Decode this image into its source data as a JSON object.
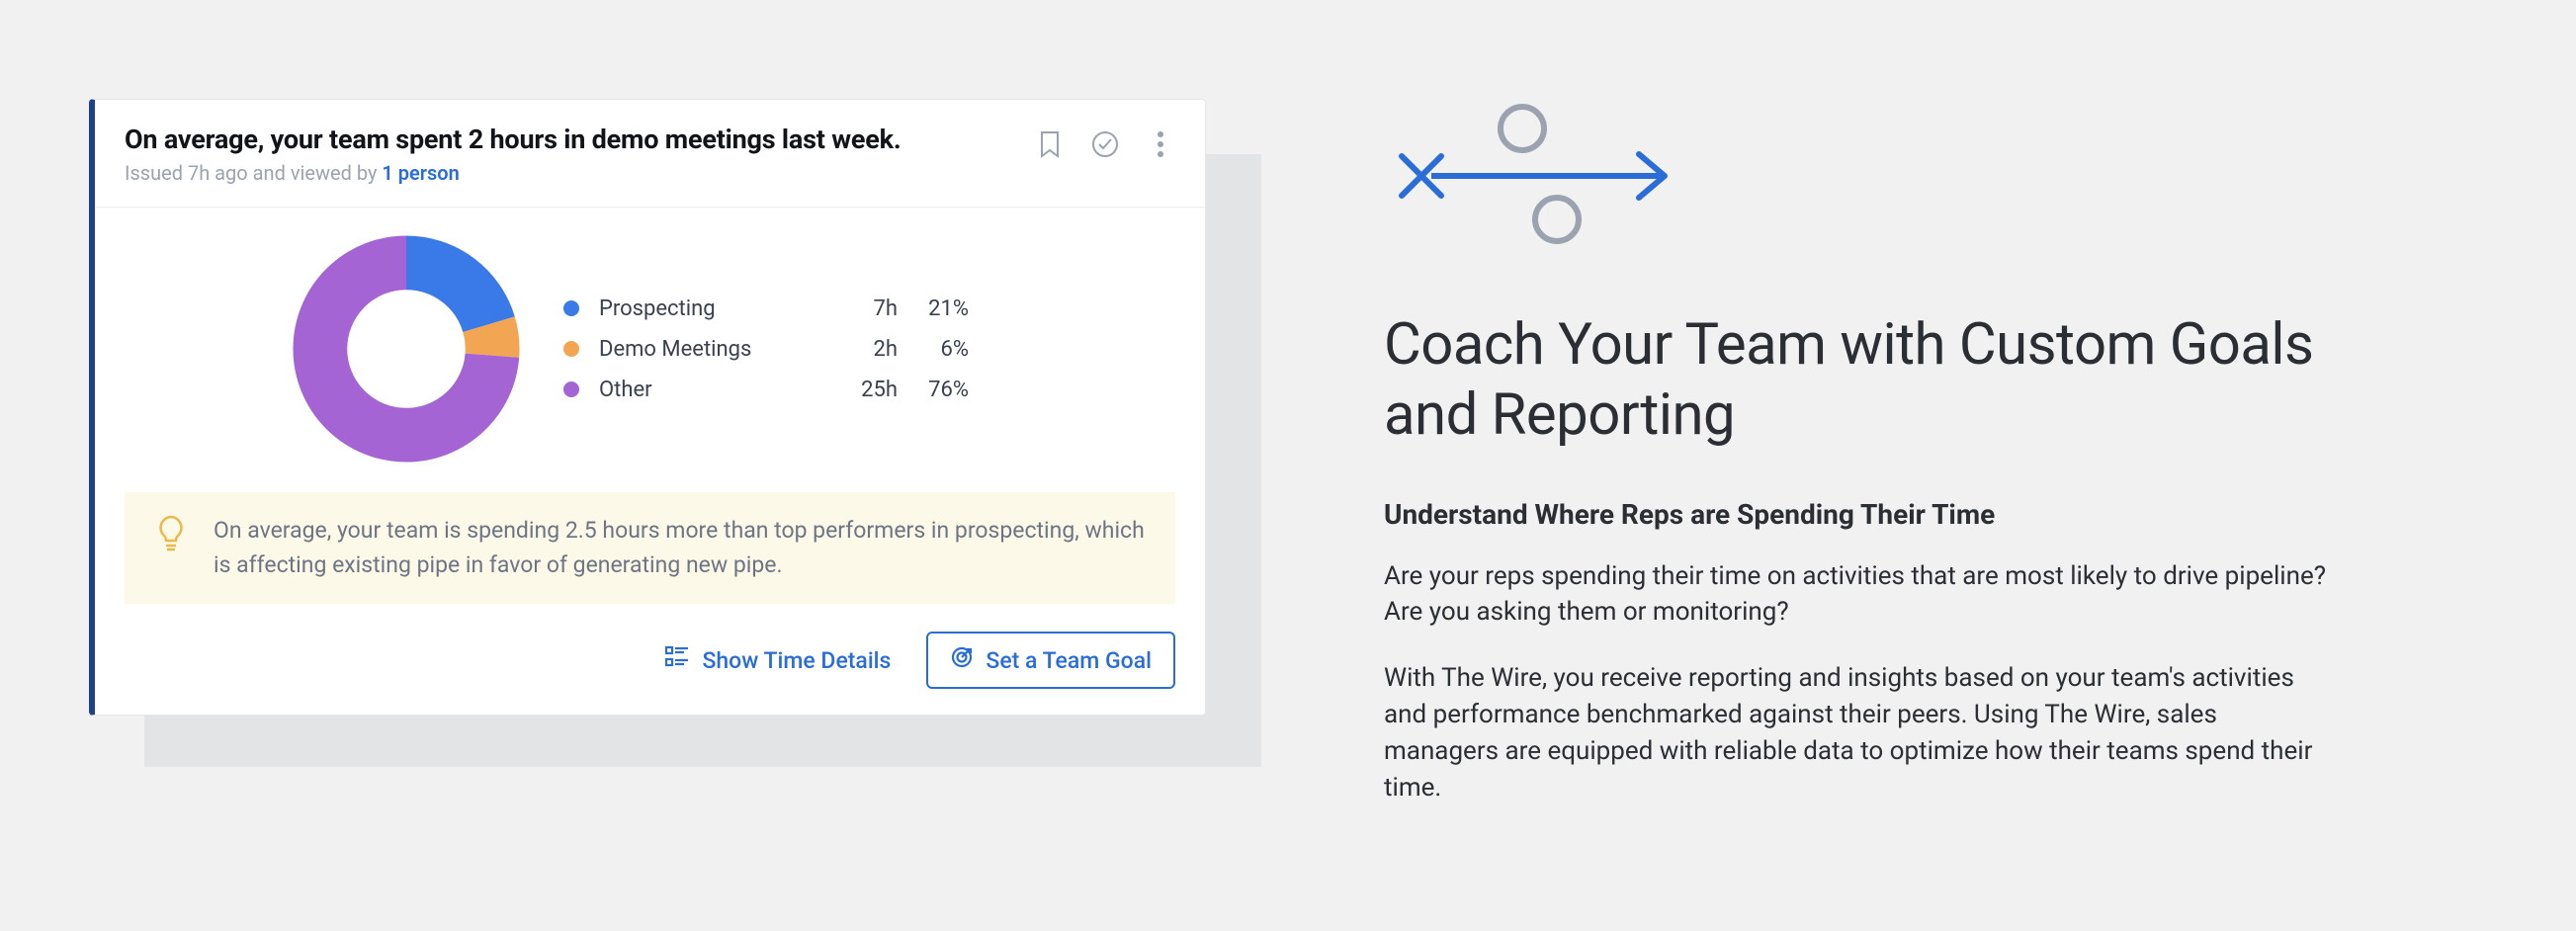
{
  "card": {
    "title": "On average, your team spent 2 hours in demo meetings last week.",
    "issued_prefix": "Issued 7h ago and viewed by ",
    "issued_accent": "1 person",
    "insight": "On average, your team is spending 2.5 hours more than top performers in prospecting, which is affecting existing pipe in favor of generating new pipe.",
    "buttons": {
      "details": "Show Time Details",
      "goal": "Set a Team Goal"
    }
  },
  "chart_data": {
    "type": "pie",
    "title": "",
    "series": [
      {
        "name": "Prospecting",
        "hours": "7h",
        "pct": "21%",
        "value": 21,
        "color": "#3a7ae8"
      },
      {
        "name": "Demo Meetings",
        "hours": "2h",
        "pct": "6%",
        "value": 6,
        "color": "#f2a654"
      },
      {
        "name": "Other",
        "hours": "25h",
        "pct": "76%",
        "value": 76,
        "color": "#a564d3"
      }
    ]
  },
  "copy": {
    "headline": "Coach Your Team with Custom Goals and Reporting",
    "subhead": "Understand Where Reps are Spending Their Time",
    "para1": "Are your reps spending their time on activities that are most likely to drive pipeline? Are you asking them or monitoring?",
    "para2": "With The Wire, you receive reporting and insights based on your team's activities and performance benchmarked against their peers. Using The Wire, sales managers are equipped with reliable data to optimize how their teams spend their time."
  }
}
